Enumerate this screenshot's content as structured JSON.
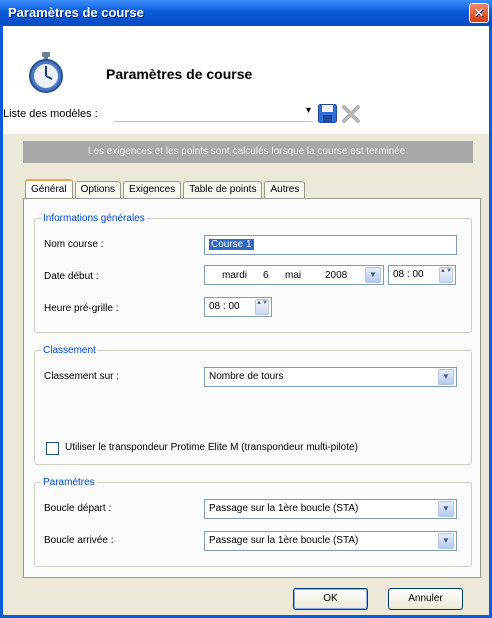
{
  "window": {
    "title": "Paramètres de course",
    "close_label": "✕"
  },
  "header": {
    "title": "Paramètres de course"
  },
  "models": {
    "label": "Liste des modèles :",
    "value": "",
    "arrow": "▾"
  },
  "banner": {
    "text": "Les exigences et les points sont calculés lorsque la course est terminée."
  },
  "tabs": [
    {
      "label": "Général",
      "active": true
    },
    {
      "label": "Options"
    },
    {
      "label": "Exigences"
    },
    {
      "label": "Table de points"
    },
    {
      "label": "Autres"
    }
  ],
  "general_info": {
    "title": "Informations générales",
    "race_name_label": "Nom course :",
    "race_name_value": "Course 1",
    "start_date_label": "Date début :",
    "start_date_day": "mardi",
    "start_date_date": "6",
    "start_date_month": "mai",
    "start_date_year": "2008",
    "start_time": "08 : 00",
    "pregrid_label": "Heure pré-grille :",
    "pregrid_time": "08 : 00"
  },
  "ranking": {
    "title": "Classement",
    "ranking_on_label": "Classement sur :",
    "ranking_on_value": "Nombre de tours",
    "transponder_label": "Utiliser le transpondeur Protime Elite M (transpondeur multi-pilote)",
    "transponder_checked": false
  },
  "parameters": {
    "title": "Paramètres",
    "start_loop_label": "Boucle départ :",
    "start_loop_value": "Passage sur la 1ère boucle (STA)",
    "finish_loop_label": "Boucle arrivée :",
    "finish_loop_value": "Passage sur la 1ère boucle (STA)"
  },
  "buttons": {
    "ok": "OK",
    "cancel": "Annuler"
  },
  "icons": {
    "spin": "▲▼",
    "dropdown": "▼"
  },
  "colors": {
    "titlebar": "#0a5bd8",
    "group_title": "#0046d5",
    "banner": "#a8a8a8"
  }
}
